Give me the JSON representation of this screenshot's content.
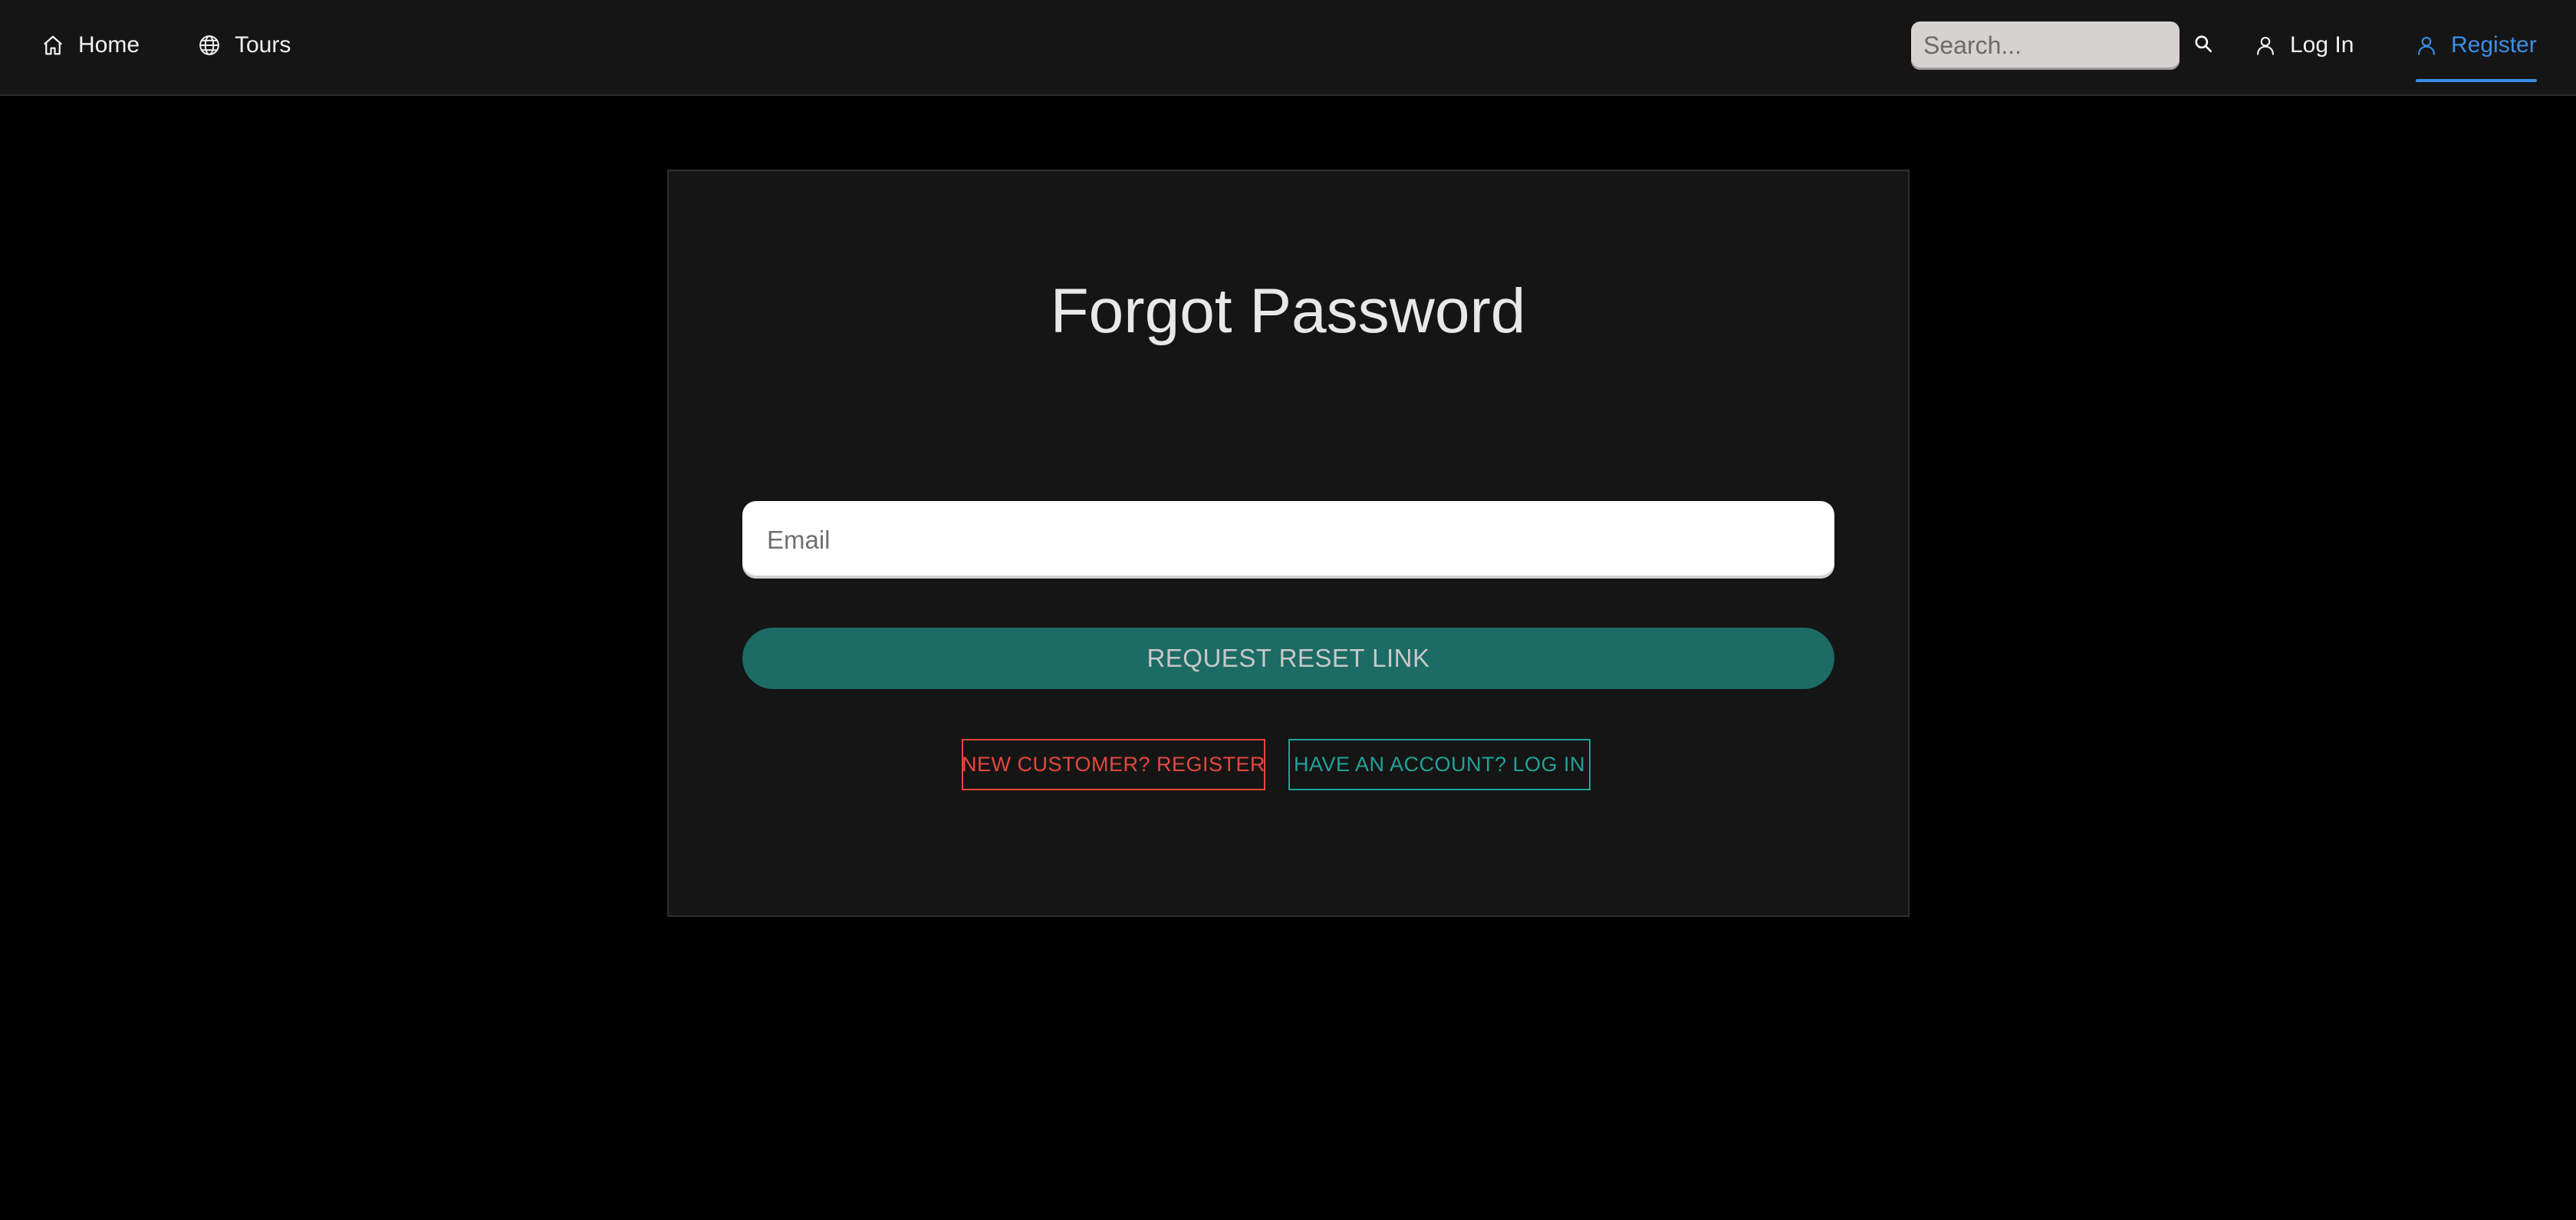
{
  "nav": {
    "home_label": "Home",
    "home_icon": "home-icon",
    "tours_label": "Tours",
    "tours_icon": "globe-icon",
    "login_label": "Log In",
    "login_icon": "user-icon",
    "register_label": "Register",
    "register_icon": "user-icon",
    "active_item": "Register"
  },
  "search": {
    "placeholder": "Search...",
    "value": "",
    "icon": "search-icon"
  },
  "form": {
    "title": "Forgot Password",
    "email_placeholder": "Email",
    "email_value": "",
    "submit_label": "REQUEST RESET LINK",
    "register_link_label": "NEW CUSTOMER? REGISTER",
    "login_link_label": "HAVE AN ACCOUNT? LOG IN"
  },
  "colors": {
    "page_background": "#000000",
    "navbar_background": "#151515",
    "card_background": "#151515",
    "accent_blue": "#3a8ee8",
    "submit_button": "#1c6b65",
    "register_outline": "#e5483b",
    "login_outline": "#1fa39a"
  }
}
